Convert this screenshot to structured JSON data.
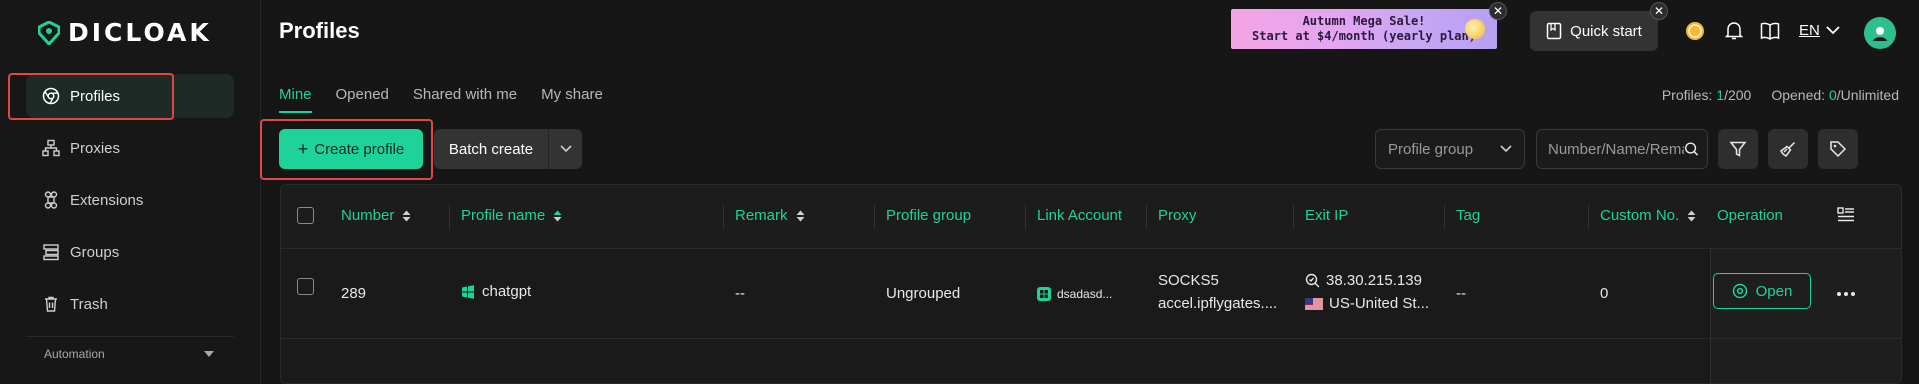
{
  "brand": {
    "name": "DICLOAK",
    "accent": "#1ed39a",
    "highlight_outline": "#e04848"
  },
  "sidebar": {
    "items": [
      {
        "label": "Profiles",
        "icon": "chrome-icon",
        "active": true
      },
      {
        "label": "Proxies",
        "icon": "network-icon"
      },
      {
        "label": "Extensions",
        "icon": "command-icon"
      },
      {
        "label": "Groups",
        "icon": "layers-icon"
      },
      {
        "label": "Trash",
        "icon": "trash-icon"
      }
    ],
    "section": "Automation"
  },
  "header": {
    "title": "Profiles",
    "promo_line1": "Autumn Mega Sale!",
    "promo_line2": "Start at $4/month (yearly plan)",
    "quick_start": "Quick start",
    "language": "EN"
  },
  "tabs": [
    {
      "label": "Mine",
      "active": true
    },
    {
      "label": "Opened"
    },
    {
      "label": "Shared with me"
    },
    {
      "label": "My share"
    }
  ],
  "stats": {
    "profiles_label": "Profiles:",
    "profiles_used": "1",
    "profiles_total": "/200",
    "opened_label": "Opened:",
    "opened_count": "0",
    "opened_total": "/Unlimited"
  },
  "toolbar": {
    "create_label": "Create profile",
    "batch_label": "Batch create",
    "group_placeholder": "Profile group",
    "search_placeholder": "Number/Name/Remarks"
  },
  "table": {
    "columns": [
      "Number",
      "Profile name",
      "Remark",
      "Profile group",
      "Link Account",
      "Proxy",
      "Exit IP",
      "Tag",
      "Custom No.",
      "Operation"
    ],
    "rows": [
      {
        "number": "289",
        "profile_name": "chatgpt",
        "remark": "--",
        "profile_group": "Ungrouped",
        "link_account": "dsadasd...",
        "proxy_type": "SOCKS5",
        "proxy_host": "accel.ipflygates....",
        "exit_ip": "38.30.215.139",
        "exit_location": "US-United St...",
        "tag": "--",
        "custom_no": "0",
        "open_label": "Open"
      }
    ]
  }
}
